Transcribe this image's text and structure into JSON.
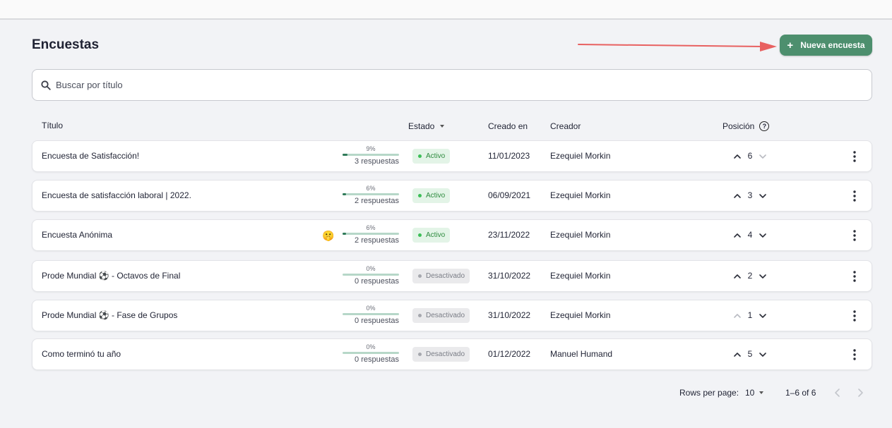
{
  "header": {
    "title": "Encuestas",
    "new_button_label": "Nueva encuesta",
    "new_button_icon": "plus-icon",
    "accent_color": "#4d8f6e",
    "annotation_arrow_color": "#e86161"
  },
  "search": {
    "placeholder": "Buscar por título",
    "value": ""
  },
  "table": {
    "columns": {
      "title": "Título",
      "status": "Estado",
      "created": "Creado en",
      "creator": "Creador",
      "position": "Posición"
    },
    "rows": [
      {
        "title": "Encuesta de Satisfacción!",
        "emoji": "",
        "percent": "9%",
        "progress": 0.09,
        "responses": "3 respuestas",
        "status": "Activo",
        "status_type": "active",
        "created": "11/01/2023",
        "creator": "Ezequiel Morkin",
        "position": "6",
        "up_enabled": true,
        "down_enabled": false
      },
      {
        "title": "Encuesta de satisfacción laboral | 2022.",
        "emoji": "",
        "percent": "6%",
        "progress": 0.06,
        "responses": "2 respuestas",
        "status": "Activo",
        "status_type": "active",
        "created": "06/09/2021",
        "creator": "Ezequiel Morkin",
        "position": "3",
        "up_enabled": true,
        "down_enabled": true
      },
      {
        "title": "Encuesta Anónima",
        "emoji": "🤫",
        "percent": "6%",
        "progress": 0.06,
        "responses": "2 respuestas",
        "status": "Activo",
        "status_type": "active",
        "created": "23/11/2022",
        "creator": "Ezequiel Morkin",
        "position": "4",
        "up_enabled": true,
        "down_enabled": true
      },
      {
        "title": "Prode Mundial ⚽ - Octavos de Final",
        "emoji": "",
        "percent": "0%",
        "progress": 0,
        "responses": "0 respuestas",
        "status": "Desactivado",
        "status_type": "inactive",
        "created": "31/10/2022",
        "creator": "Ezequiel Morkin",
        "position": "2",
        "up_enabled": true,
        "down_enabled": true
      },
      {
        "title": "Prode Mundial ⚽ - Fase de Grupos",
        "emoji": "",
        "percent": "0%",
        "progress": 0,
        "responses": "0 respuestas",
        "status": "Desactivado",
        "status_type": "inactive",
        "created": "31/10/2022",
        "creator": "Ezequiel Morkin",
        "position": "1",
        "up_enabled": false,
        "down_enabled": true
      },
      {
        "title": "Como terminó tu año",
        "emoji": "",
        "percent": "0%",
        "progress": 0,
        "responses": "0 respuestas",
        "status": "Desactivado",
        "status_type": "inactive",
        "created": "01/12/2022",
        "creator": "Manuel Humand",
        "position": "5",
        "up_enabled": true,
        "down_enabled": true
      }
    ]
  },
  "pagination": {
    "rows_per_page_label": "Rows per page:",
    "rows_per_page_value": "10",
    "range": "1–6 of 6",
    "prev_enabled": false,
    "next_enabled": false
  }
}
